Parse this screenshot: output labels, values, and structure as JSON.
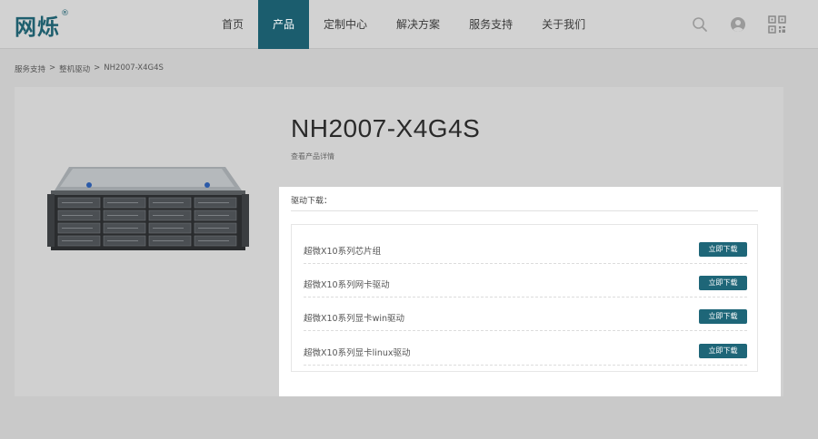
{
  "brand": {
    "logo_text": "网烁",
    "logo_mark": "®"
  },
  "nav": {
    "items": [
      {
        "label": "首页"
      },
      {
        "label": "产品"
      },
      {
        "label": "定制中心"
      },
      {
        "label": "解决方案"
      },
      {
        "label": "服务支持"
      },
      {
        "label": "关于我们"
      }
    ],
    "active_index": 1
  },
  "header_icons": [
    "search-icon",
    "user-icon",
    "qrcode-icon"
  ],
  "breadcrumb": {
    "items": [
      "服务支持",
      "整机驱动",
      "NH2007-X4G4S"
    ],
    "separator": ">"
  },
  "product": {
    "title": "NH2007-X4G4S",
    "subtitle": "查看产品详情"
  },
  "downloads": {
    "header": "驱动下载：",
    "items": [
      {
        "name": "超微X10系列芯片组",
        "button": "立即下载"
      },
      {
        "name": "超微X10系列网卡驱动",
        "button": "立即下载"
      },
      {
        "name": "超微X10系列显卡win驱动",
        "button": "立即下载"
      },
      {
        "name": "超微X10系列显卡linux驱动",
        "button": "立即下载"
      }
    ]
  },
  "colors": {
    "accent": "#1b5d6e",
    "button": "#1e6678",
    "page_bg": "#c9c9c9",
    "panel_bg": "#d0d0d0"
  }
}
